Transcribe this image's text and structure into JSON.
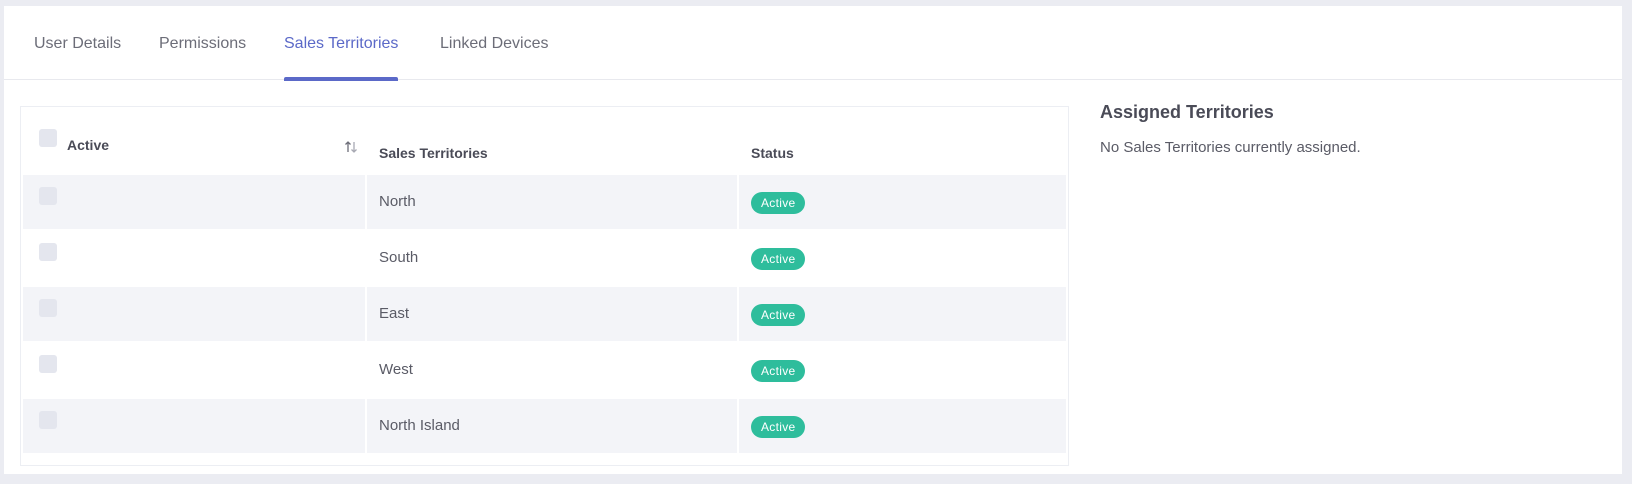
{
  "tabs": [
    {
      "label": "User Details",
      "active": false
    },
    {
      "label": "Permissions",
      "active": false
    },
    {
      "label": "Sales Territories",
      "active": true
    },
    {
      "label": "Linked Devices",
      "active": false
    }
  ],
  "table": {
    "headers": {
      "active": "Active",
      "territories": "Sales Territories",
      "status": "Status"
    },
    "sort_icon": "sort-arrows-icon",
    "rows": [
      {
        "territory": "North",
        "status": "Active"
      },
      {
        "territory": "South",
        "status": "Active"
      },
      {
        "territory": "East",
        "status": "Active"
      },
      {
        "territory": "West",
        "status": "Active"
      },
      {
        "territory": "North Island",
        "status": "Active"
      }
    ]
  },
  "assigned": {
    "title": "Assigned Territories",
    "empty_text": "No Sales Territories currently assigned."
  },
  "colors": {
    "accent": "#5b69c8",
    "status_active": "#2ebd9c",
    "row_shaded": "#f3f4f8",
    "background": "#ebecf2"
  }
}
